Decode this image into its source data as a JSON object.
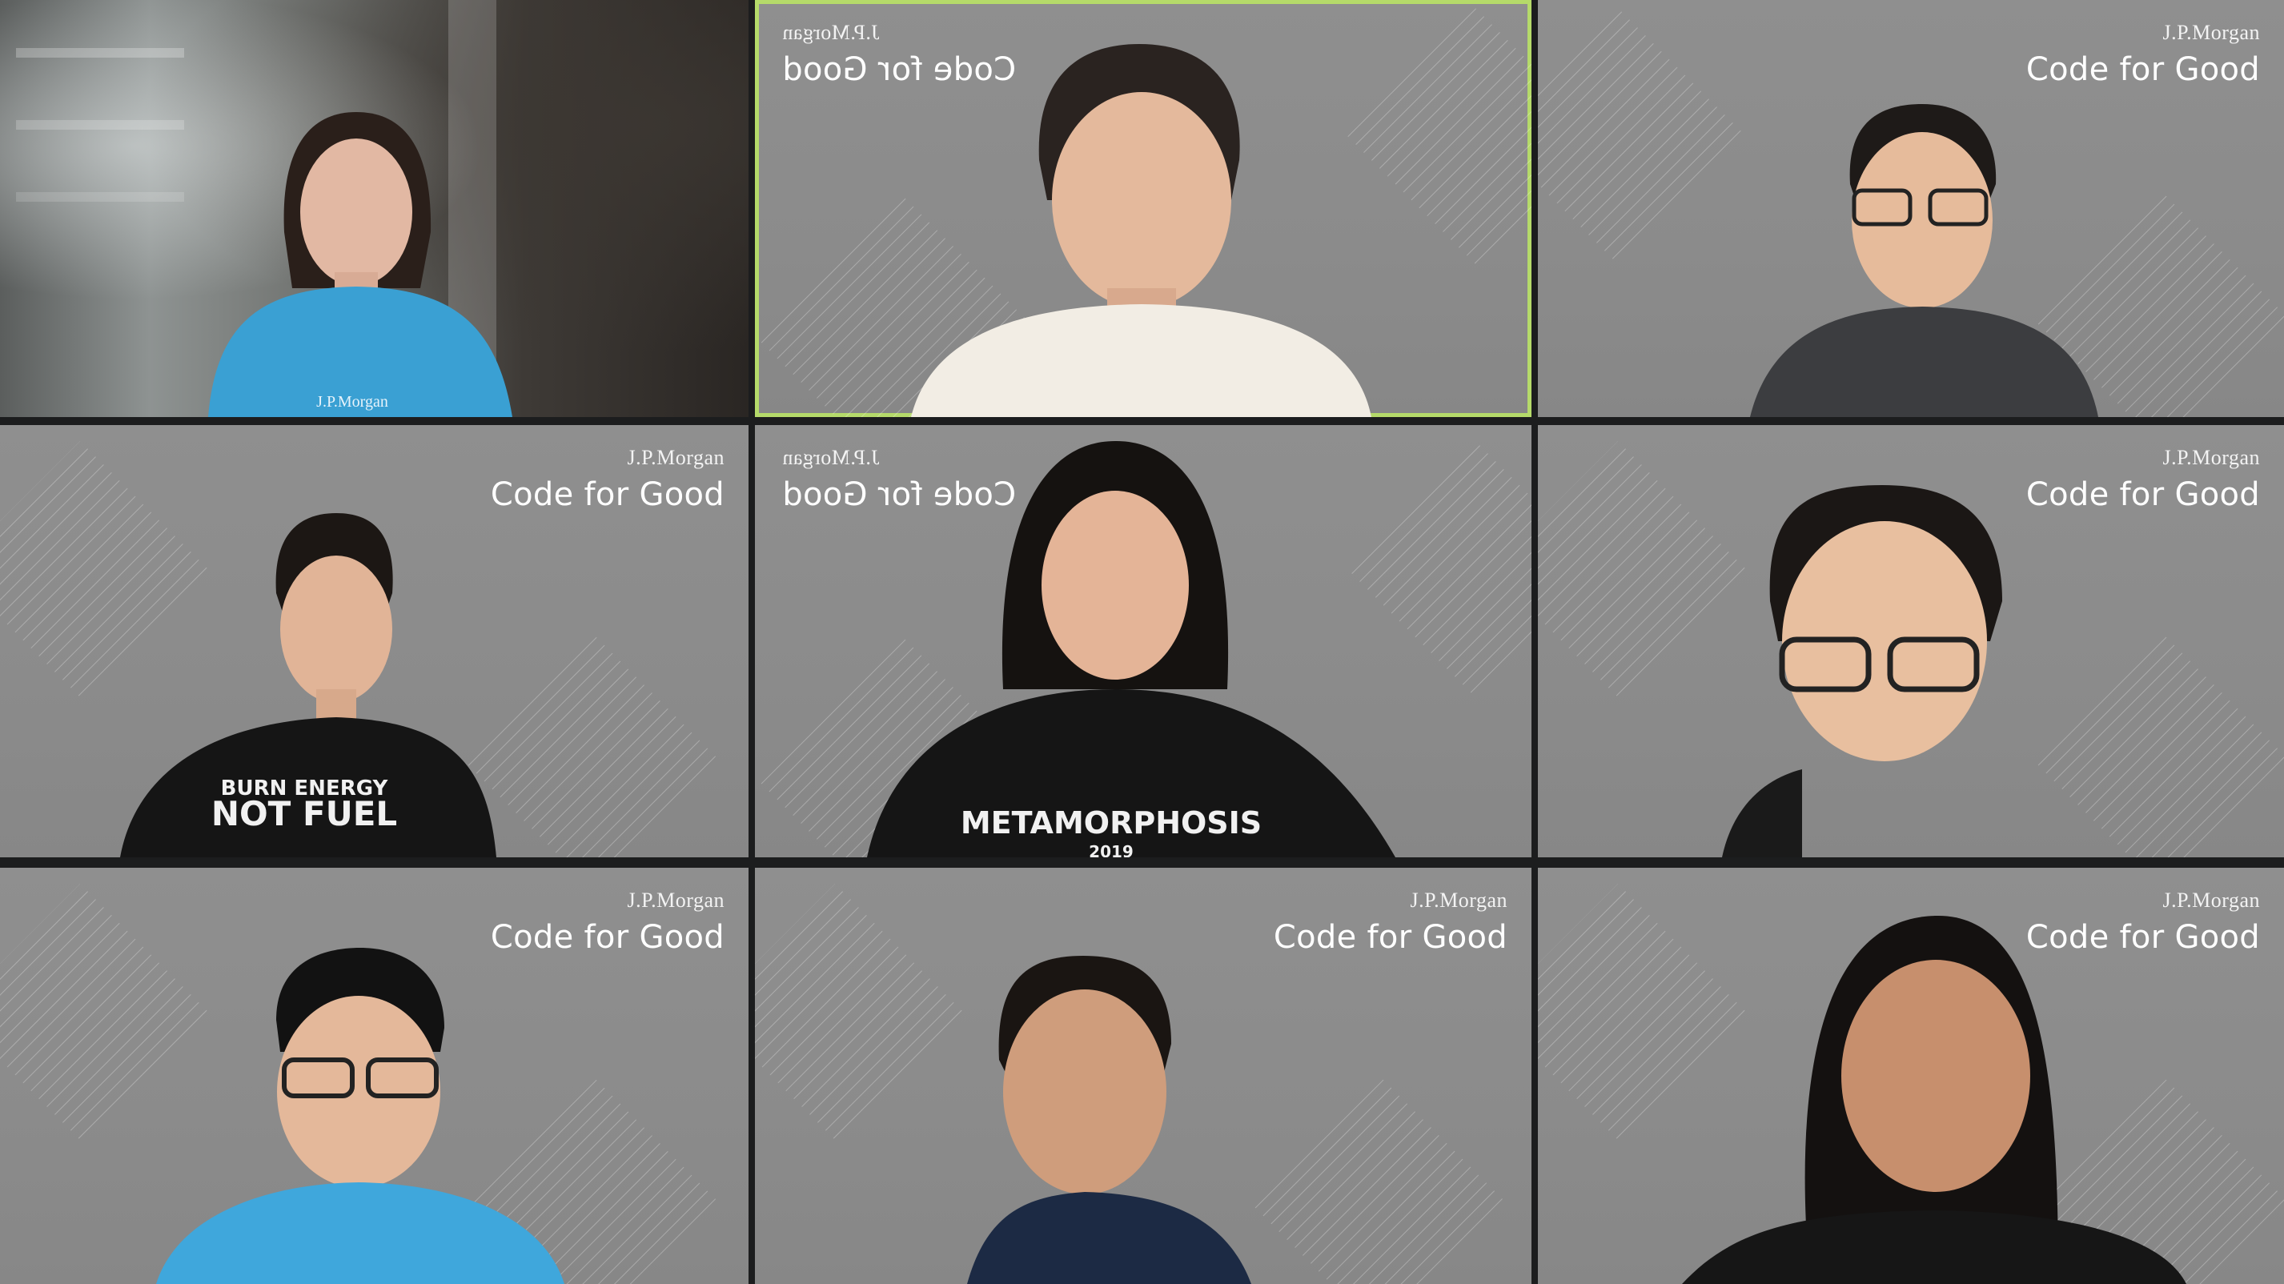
{
  "meeting": {
    "participants": [
      {
        "id": "p1",
        "background": "room",
        "active": false,
        "brand": null,
        "shirt_text": "J.P.Morgan"
      },
      {
        "id": "p2",
        "background": "code-for-good",
        "active": true,
        "mirrored": true,
        "brand": {
          "logo": "J.P.Morgan",
          "title": "Code for Good"
        }
      },
      {
        "id": "p3",
        "background": "code-for-good",
        "active": false,
        "mirrored": false,
        "brand": {
          "logo": "J.P.Morgan",
          "title": "Code for Good"
        }
      },
      {
        "id": "p4",
        "background": "code-for-good",
        "active": false,
        "mirrored": false,
        "brand": {
          "logo": "J.P.Morgan",
          "title": "Code for Good"
        },
        "shirt_text": [
          "BURN ENERGY",
          "NOT FUEL"
        ]
      },
      {
        "id": "p5",
        "background": "code-for-good",
        "active": false,
        "mirrored": true,
        "brand": {
          "logo": "J.P.Morgan",
          "title": "Code for Good"
        },
        "shirt_text": [
          "METAMORPHOSIS",
          "2019"
        ]
      },
      {
        "id": "p6",
        "background": "code-for-good",
        "active": false,
        "mirrored": false,
        "brand": {
          "logo": "J.P.Morgan",
          "title": "Code for Good"
        }
      },
      {
        "id": "p7",
        "background": "code-for-good",
        "active": false,
        "mirrored": false,
        "brand": {
          "logo": "J.P.Morgan",
          "title": "Code for Good"
        }
      },
      {
        "id": "p8",
        "background": "code-for-good",
        "active": false,
        "mirrored": false,
        "brand": {
          "logo": "J.P.Morgan",
          "title": "Code for Good"
        }
      },
      {
        "id": "p9",
        "background": "code-for-good",
        "active": false,
        "mirrored": false,
        "brand": {
          "logo": "J.P.Morgan",
          "title": "Code for Good"
        }
      }
    ]
  },
  "colors": {
    "active_border": "#b5da6a",
    "gap": "#1c1d1e",
    "virtual_background": "#8d8d8d"
  }
}
